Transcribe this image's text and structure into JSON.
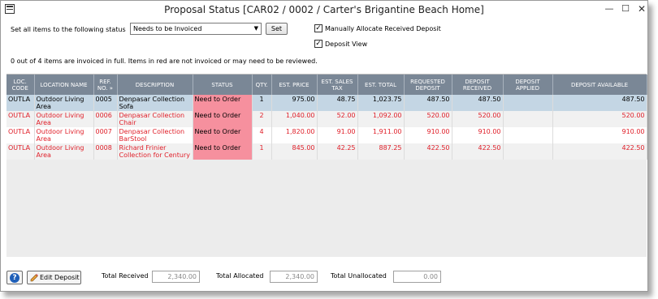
{
  "window": {
    "title": "Proposal Status [CAR02 / 0002 / Carter's Brigantine Beach Home]",
    "minimize_glyph": "—",
    "maximize_glyph": "☐",
    "close_glyph": "✕"
  },
  "controls": {
    "set_all_label": "Set all items to the following status",
    "status_value": "Needs to be Invoiced",
    "dropdown_glyph": "▼",
    "set_label": "Set",
    "manual_allocate_label": "Manually Allocate Received Deposit",
    "manual_allocate_checked": true,
    "deposit_view_label": "Deposit View",
    "deposit_view_checked": true,
    "check_glyph": "✓"
  },
  "info_text": "0 out of 4 items are invoiced in full.  Items in red are not invoiced or may need to be reviewed.",
  "table": {
    "headers": {
      "loc_code": [
        "LOC.",
        "CODE"
      ],
      "location_name": "LOCATION NAME",
      "ref_no": [
        "REF.",
        "NO. »"
      ],
      "description": "DESCRIPTION",
      "status": "STATUS",
      "qty": "QTY.",
      "est_price": "EST. PRICE",
      "est_sales_tax": [
        "EST. SALES",
        "TAX"
      ],
      "est_total": "EST. TOTAL",
      "requested_deposit": [
        "REQUESTED",
        "DEPOSIT"
      ],
      "deposit_received": [
        "DEPOSIT",
        "RECEIVED"
      ],
      "deposit_applied": [
        "DEPOSIT",
        "APPLIED"
      ],
      "deposit_available": "DEPOSIT AVAILABLE"
    },
    "rows": [
      {
        "loc_code": "OUTLA",
        "location": [
          "Outdoor Living",
          "Area"
        ],
        "ref": "0005",
        "description": [
          "Denpasar Collection",
          "Sofa"
        ],
        "status": "Need to Order",
        "qty": "1",
        "est_price": "975.00",
        "tax": "48.75",
        "total": "1,023.75",
        "requested": "487.50",
        "received": "487.50",
        "applied": "",
        "available": "487.50"
      },
      {
        "loc_code": "OUTLA",
        "location": [
          "Outdoor Living",
          "Area"
        ],
        "ref": "0006",
        "description": [
          "Denpasar Collection",
          "Chair"
        ],
        "status": "Need to Order",
        "qty": "2",
        "est_price": "1,040.00",
        "tax": "52.00",
        "total": "1,092.00",
        "requested": "520.00",
        "received": "520.00",
        "applied": "",
        "available": "520.00"
      },
      {
        "loc_code": "OUTLA",
        "location": [
          "Outdoor Living",
          "Area"
        ],
        "ref": "0007",
        "description": [
          "Denpasar Collection",
          "BarStool"
        ],
        "status": "Need to Order",
        "qty": "4",
        "est_price": "1,820.00",
        "tax": "91.00",
        "total": "1,911.00",
        "requested": "910.00",
        "received": "910.00",
        "applied": "",
        "available": "910.00"
      },
      {
        "loc_code": "OUTLA",
        "location": [
          "Outdoor Living",
          "Area"
        ],
        "ref": "0008",
        "description": [
          "Richard Frinier",
          "Collection for Century"
        ],
        "status": "Need to Order",
        "qty": "1",
        "est_price": "845.00",
        "tax": "42.25",
        "total": "887.25",
        "requested": "422.50",
        "received": "422.50",
        "applied": "",
        "available": "422.50"
      }
    ]
  },
  "footer": {
    "help_glyph": "?",
    "edit_deposit_label": "Edit Deposit",
    "total_received_label": "Total Received",
    "total_received_value": "2,340.00",
    "total_allocated_label": "Total Allocated",
    "total_allocated_value": "2,340.00",
    "total_unallocated_label": "Total Unallocated",
    "total_unallocated_value": "0.00"
  }
}
